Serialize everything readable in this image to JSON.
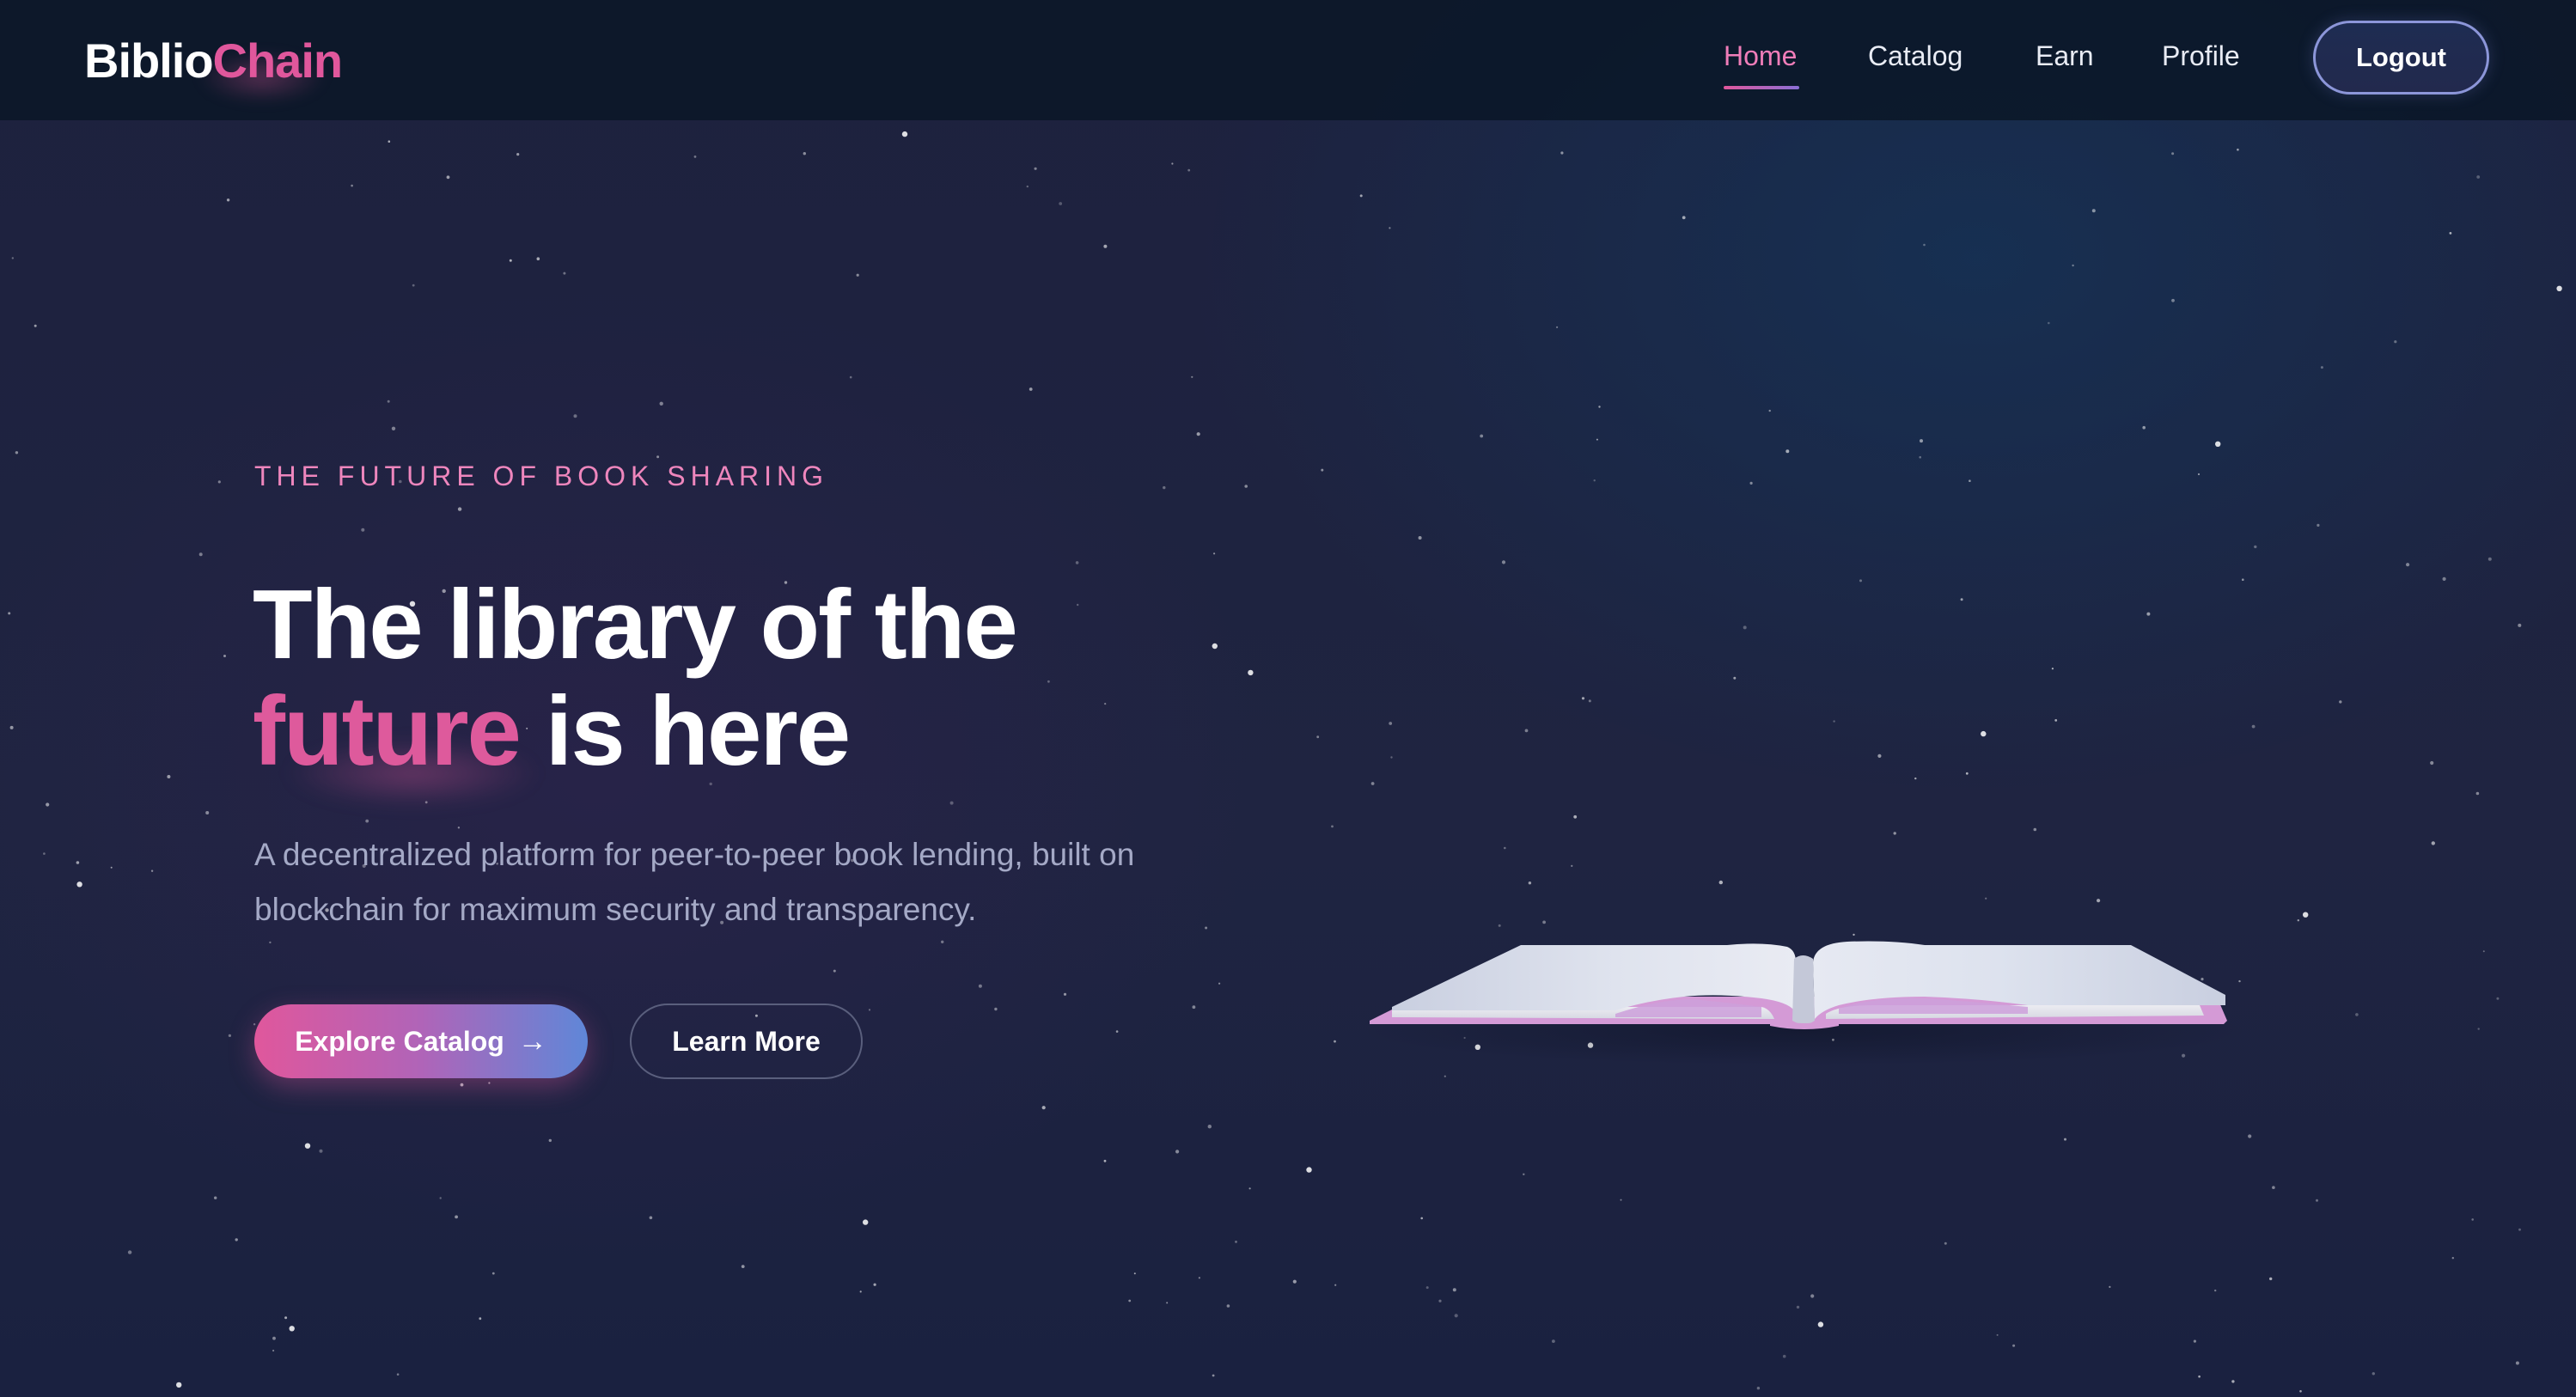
{
  "brand": {
    "name_part1": "Biblio",
    "name_part2": "Chain",
    "accent_color": "#e0579c"
  },
  "nav": {
    "items": [
      {
        "label": "Home",
        "active": true
      },
      {
        "label": "Catalog",
        "active": false
      },
      {
        "label": "Earn",
        "active": false
      },
      {
        "label": "Profile",
        "active": false
      }
    ],
    "logout_label": "Logout"
  },
  "hero": {
    "eyebrow": "THE FUTURE OF BOOK SHARING",
    "headline_line1": "The library of the",
    "headline_accent": "future",
    "headline_rest": " is here",
    "description": "A decentralized platform for peer-to-peer book lending, built on blockchain for maximum security and transparency.",
    "primary_button": "Explore Catalog",
    "primary_button_icon": "arrow-right-icon",
    "secondary_button": "Learn More"
  },
  "illustration": {
    "name": "open-book-icon"
  },
  "colors": {
    "background": "#1f2441",
    "nav_background": "#0a1626",
    "accent_pink": "#e0579c",
    "accent_blue": "#5f87d8",
    "text_muted": "#a4a9c6"
  }
}
